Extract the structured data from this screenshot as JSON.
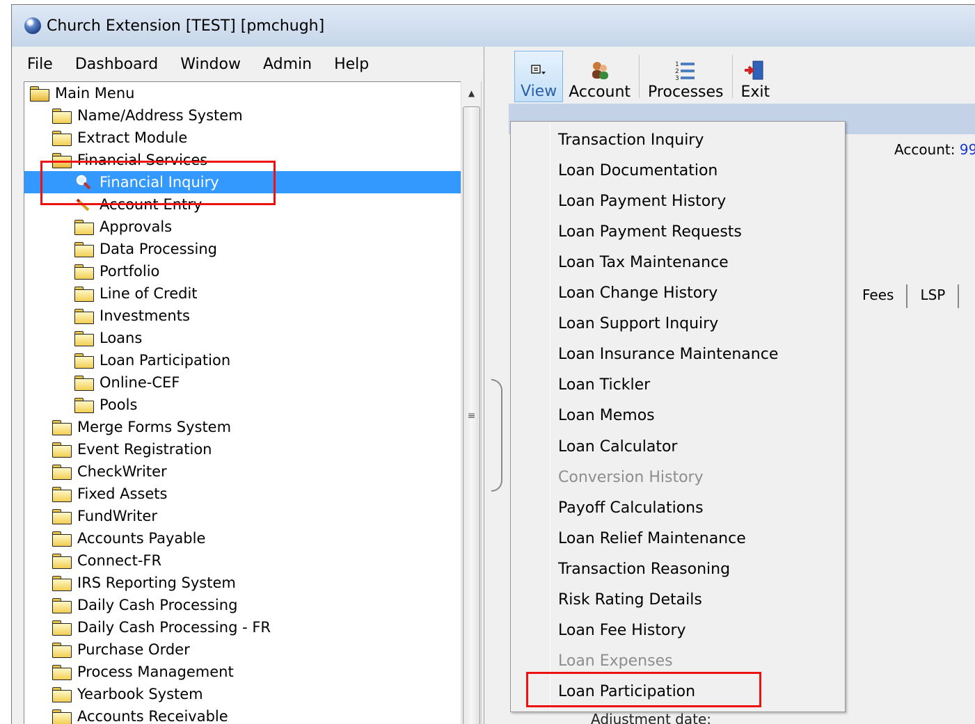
{
  "window": {
    "title": "Church Extension [TEST] [pmchugh]"
  },
  "menubar": [
    "File",
    "Dashboard",
    "Window",
    "Admin",
    "Help"
  ],
  "tree": {
    "items": [
      {
        "label": "Main Menu",
        "icon": "folder-open-icon"
      },
      {
        "label": "Name/Address System",
        "icon": "folder-icon"
      },
      {
        "label": "Extract Module",
        "icon": "folder-icon"
      },
      {
        "label": "Financial Services",
        "icon": "folder-open-icon"
      },
      {
        "label": "Financial Inquiry",
        "icon": "magnifier-icon",
        "selected": true
      },
      {
        "label": "Account Entry",
        "icon": "pencil-icon"
      },
      {
        "label": "Approvals",
        "icon": "folder-icon"
      },
      {
        "label": "Data Processing",
        "icon": "folder-icon"
      },
      {
        "label": "Portfolio",
        "icon": "folder-icon"
      },
      {
        "label": "Line of Credit",
        "icon": "folder-icon"
      },
      {
        "label": "Investments",
        "icon": "folder-icon"
      },
      {
        "label": "Loans",
        "icon": "folder-icon"
      },
      {
        "label": "Loan Participation",
        "icon": "folder-icon"
      },
      {
        "label": "Online-CEF",
        "icon": "folder-icon"
      },
      {
        "label": "Pools",
        "icon": "folder-icon"
      },
      {
        "label": "Merge Forms System",
        "icon": "folder-icon"
      },
      {
        "label": "Event Registration",
        "icon": "folder-icon"
      },
      {
        "label": "CheckWriter",
        "icon": "folder-icon"
      },
      {
        "label": "Fixed Assets",
        "icon": "folder-icon"
      },
      {
        "label": "FundWriter",
        "icon": "folder-icon"
      },
      {
        "label": "Accounts Payable",
        "icon": "folder-icon"
      },
      {
        "label": "Connect-FR",
        "icon": "folder-icon"
      },
      {
        "label": "IRS Reporting System",
        "icon": "folder-icon"
      },
      {
        "label": "Daily Cash Processing",
        "icon": "folder-icon"
      },
      {
        "label": "Daily Cash Processing - FR",
        "icon": "folder-icon"
      },
      {
        "label": "Purchase Order",
        "icon": "folder-icon"
      },
      {
        "label": "Process Management",
        "icon": "folder-icon"
      },
      {
        "label": "Yearbook System",
        "icon": "folder-icon"
      },
      {
        "label": "Accounts Receivable",
        "icon": "folder-icon"
      }
    ]
  },
  "toolbar": {
    "view_label": "View",
    "account_label": "Account",
    "processes_label": "Processes",
    "exit_label": "Exit"
  },
  "account": {
    "label": "Account:",
    "value": "99"
  },
  "tabs": [
    "Fees",
    "LSP"
  ],
  "background_text": "Adjustment date:",
  "view_menu": {
    "items": [
      {
        "label": "Transaction Inquiry",
        "enabled": true
      },
      {
        "label": "Loan Documentation",
        "enabled": true
      },
      {
        "label": "Loan Payment History",
        "enabled": true
      },
      {
        "label": "Loan Payment Requests",
        "enabled": true
      },
      {
        "label": "Loan Tax Maintenance",
        "enabled": true
      },
      {
        "label": "Loan Change History",
        "enabled": true
      },
      {
        "label": "Loan Support Inquiry",
        "enabled": true
      },
      {
        "label": "Loan Insurance Maintenance",
        "enabled": true
      },
      {
        "label": "Loan Tickler",
        "enabled": true
      },
      {
        "label": "Loan Memos",
        "enabled": true
      },
      {
        "label": "Loan Calculator",
        "enabled": true
      },
      {
        "label": "Conversion History",
        "enabled": false
      },
      {
        "label": "Payoff Calculations",
        "enabled": true
      },
      {
        "label": "Loan Relief Maintenance",
        "enabled": true
      },
      {
        "label": "Transaction Reasoning",
        "enabled": true
      },
      {
        "label": "Risk Rating Details",
        "enabled": true
      },
      {
        "label": "Loan Fee History",
        "enabled": true
      },
      {
        "label": "Loan Expenses",
        "enabled": false
      },
      {
        "label": "Loan Participation",
        "enabled": true
      }
    ]
  },
  "colors": {
    "selection": "#3399ff",
    "highlight_box": "#ee1111",
    "header_bar": "#c3d2e6",
    "disabled_text": "#8d8d8d"
  }
}
